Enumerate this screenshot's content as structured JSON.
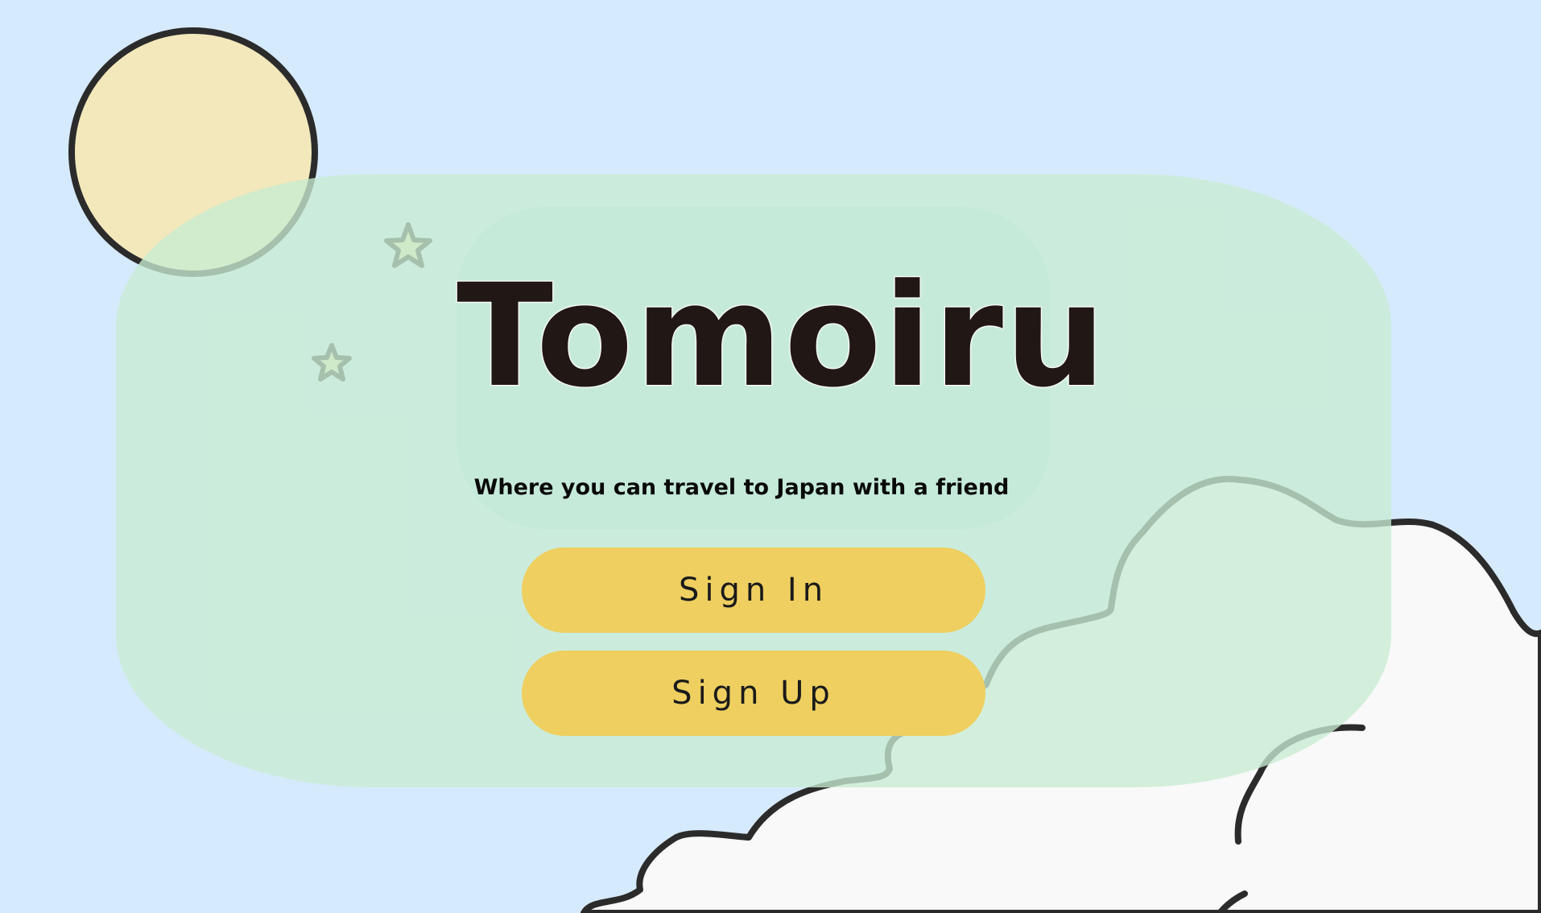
{
  "app": {
    "title": "Tomoiru",
    "tagline": "Where you can travel to Japan with a friend"
  },
  "actions": {
    "sign_in_label": "Sign In",
    "sign_up_label": "Sign Up"
  },
  "colors": {
    "sky": "#d6eafd",
    "moon": "#f2e8bb",
    "panel": "#c8ecd2",
    "button": "#eecf60",
    "title_text": "#211714",
    "cloud": "#f9f9f9"
  },
  "icons": [
    "moon-icon",
    "star-icon",
    "cloud-icon"
  ]
}
